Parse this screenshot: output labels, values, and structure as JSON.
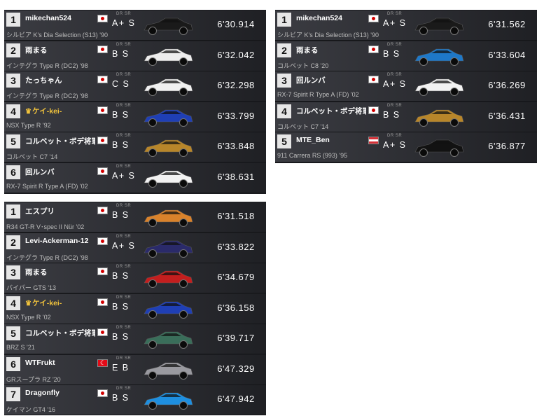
{
  "boards": [
    {
      "rows": [
        {
          "pos": "1",
          "name": "mikechan524",
          "crown": false,
          "flag": "jp",
          "drsr": "A+ S",
          "car": "シルビア K's Dia Selection (S13) '90",
          "time": "6'30.914",
          "car_color": "#1a1a1a"
        },
        {
          "pos": "2",
          "name": "雨まる",
          "crown": false,
          "flag": "jp",
          "drsr": "B S",
          "car": "インテグラ Type R (DC2) '98",
          "time": "6'32.042",
          "car_color": "#ededed"
        },
        {
          "pos": "3",
          "name": "たっちゃん",
          "crown": false,
          "flag": "jp",
          "drsr": "C S",
          "car": "インテグラ Type R (DC2) '98",
          "time": "6'32.298",
          "car_color": "#f0f0f0"
        },
        {
          "pos": "4",
          "name": "ケイ-kei-",
          "crown": true,
          "flag": "jp",
          "drsr": "B S",
          "car": "NSX Type R '92",
          "time": "6'33.799",
          "car_color": "#1f3fb5"
        },
        {
          "pos": "5",
          "name": "コルベット・ボデ将軍",
          "crown": false,
          "flag": "jp",
          "drsr": "B S",
          "car": "コルベット C7 '14",
          "time": "6'33.848",
          "car_color": "#b8862a"
        },
        {
          "pos": "6",
          "name": "回ルンバ",
          "crown": false,
          "flag": "jp",
          "drsr": "A+ S",
          "car": "RX-7 Spirit R Type A (FD) '02",
          "time": "6'38.631",
          "car_color": "#f2f2f2"
        }
      ]
    },
    {
      "rows": [
        {
          "pos": "1",
          "name": "mikechan524",
          "crown": false,
          "flag": "jp",
          "drsr": "A+ S",
          "car": "シルビア K's Dia Selection (S13) '90",
          "time": "6'31.562",
          "car_color": "#1a1a1a"
        },
        {
          "pos": "2",
          "name": "雨まる",
          "crown": false,
          "flag": "jp",
          "drsr": "B S",
          "car": "コルベット C8 '20",
          "time": "6'33.604",
          "car_color": "#1e78c8"
        },
        {
          "pos": "3",
          "name": "回ルンバ",
          "crown": false,
          "flag": "jp",
          "drsr": "A+ S",
          "car": "RX-7 Spirit R Type A (FD) '02",
          "time": "6'36.269",
          "car_color": "#f2f2f2"
        },
        {
          "pos": "4",
          "name": "コルベット・ボデ将軍",
          "crown": false,
          "flag": "jp",
          "drsr": "B S",
          "car": "コルベット C7 '14",
          "time": "6'36.431",
          "car_color": "#b8862a"
        },
        {
          "pos": "5",
          "name": "MTE_Ben",
          "crown": false,
          "flag": "at",
          "drsr": "A+ S",
          "car": "911 Carrera RS (993) '95",
          "time": "6'36.877",
          "car_color": "#121212"
        }
      ]
    },
    {
      "rows": [
        {
          "pos": "1",
          "name": "エスプリ",
          "crown": false,
          "flag": "jp",
          "drsr": "B S",
          "car": "R34 GT-R V･spec II Nür '02",
          "time": "6'31.518",
          "car_color": "#d9822b"
        },
        {
          "pos": "2",
          "name": "Levi-Ackerman-12",
          "crown": false,
          "flag": "jp",
          "drsr": "A+ S",
          "car": "インテグラ Type R (DC2) '98",
          "time": "6'33.822",
          "car_color": "#2a2a6a"
        },
        {
          "pos": "3",
          "name": "雨まる",
          "crown": false,
          "flag": "jp",
          "drsr": "B S",
          "car": "バイパー GTS '13",
          "time": "6'34.679",
          "car_color": "#c41e1e"
        },
        {
          "pos": "4",
          "name": "ケイ-kei-",
          "crown": true,
          "flag": "jp",
          "drsr": "B S",
          "car": "NSX Type R '02",
          "time": "6'36.158",
          "car_color": "#1f3fb5"
        },
        {
          "pos": "5",
          "name": "コルベット・ボデ将軍",
          "crown": false,
          "flag": "jp",
          "drsr": "B S",
          "car": "BRZ S '21",
          "time": "6'39.717",
          "car_color": "#3a6e5a"
        },
        {
          "pos": "6",
          "name": "WTFrukt",
          "crown": false,
          "flag": "tr",
          "drsr": "E B",
          "car": "GRスープラ RZ '20",
          "time": "6'47.329",
          "car_color": "#9a9aa0"
        },
        {
          "pos": "7",
          "name": "Dragonfly",
          "crown": false,
          "flag": "jp",
          "drsr": "B S",
          "car": "ケイマン GT4 '16",
          "time": "6'47.942",
          "car_color": "#1e8fe0"
        }
      ]
    }
  ],
  "labels": {
    "dr": "DR",
    "sr": "SR",
    "crown_icon": "♛"
  }
}
